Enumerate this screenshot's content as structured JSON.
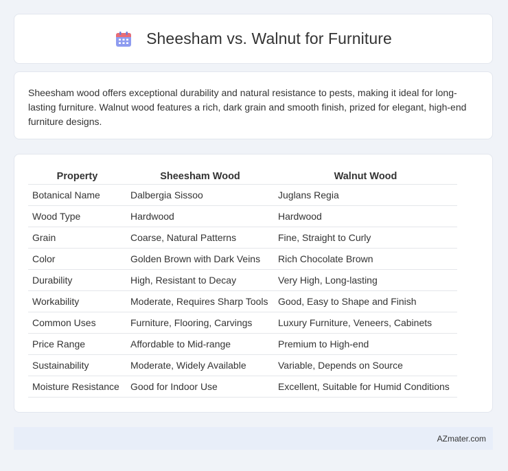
{
  "header": {
    "title": "Sheesham vs. Walnut for Furniture",
    "icon": "calendar-icon",
    "icon_colors": {
      "top": "#e96c74",
      "body": "#8e9cf0"
    }
  },
  "intro": {
    "text": "Sheesham wood offers exceptional durability and natural resistance to pests, making it ideal for long-lasting furniture. Walnut wood features a rich, dark grain and smooth finish, prized for elegant, high-end furniture designs."
  },
  "table": {
    "headers": [
      "Property",
      "Sheesham Wood",
      "Walnut Wood"
    ],
    "rows": [
      [
        "Botanical Name",
        "Dalbergia Sissoo",
        "Juglans Regia"
      ],
      [
        "Wood Type",
        "Hardwood",
        "Hardwood"
      ],
      [
        "Grain",
        "Coarse, Natural Patterns",
        "Fine, Straight to Curly"
      ],
      [
        "Color",
        "Golden Brown with Dark Veins",
        "Rich Chocolate Brown"
      ],
      [
        "Durability",
        "High, Resistant to Decay",
        "Very High, Long-lasting"
      ],
      [
        "Workability",
        "Moderate, Requires Sharp Tools",
        "Good, Easy to Shape and Finish"
      ],
      [
        "Common Uses",
        "Furniture, Flooring, Carvings",
        "Luxury Furniture, Veneers, Cabinets"
      ],
      [
        "Price Range",
        "Affordable to Mid-range",
        "Premium to High-end"
      ],
      [
        "Sustainability",
        "Moderate, Widely Available",
        "Variable, Depends on Source"
      ],
      [
        "Moisture Resistance",
        "Good for Indoor Use",
        "Excellent, Suitable for Humid Conditions"
      ]
    ]
  },
  "footer": {
    "text": "AZmater.com"
  }
}
